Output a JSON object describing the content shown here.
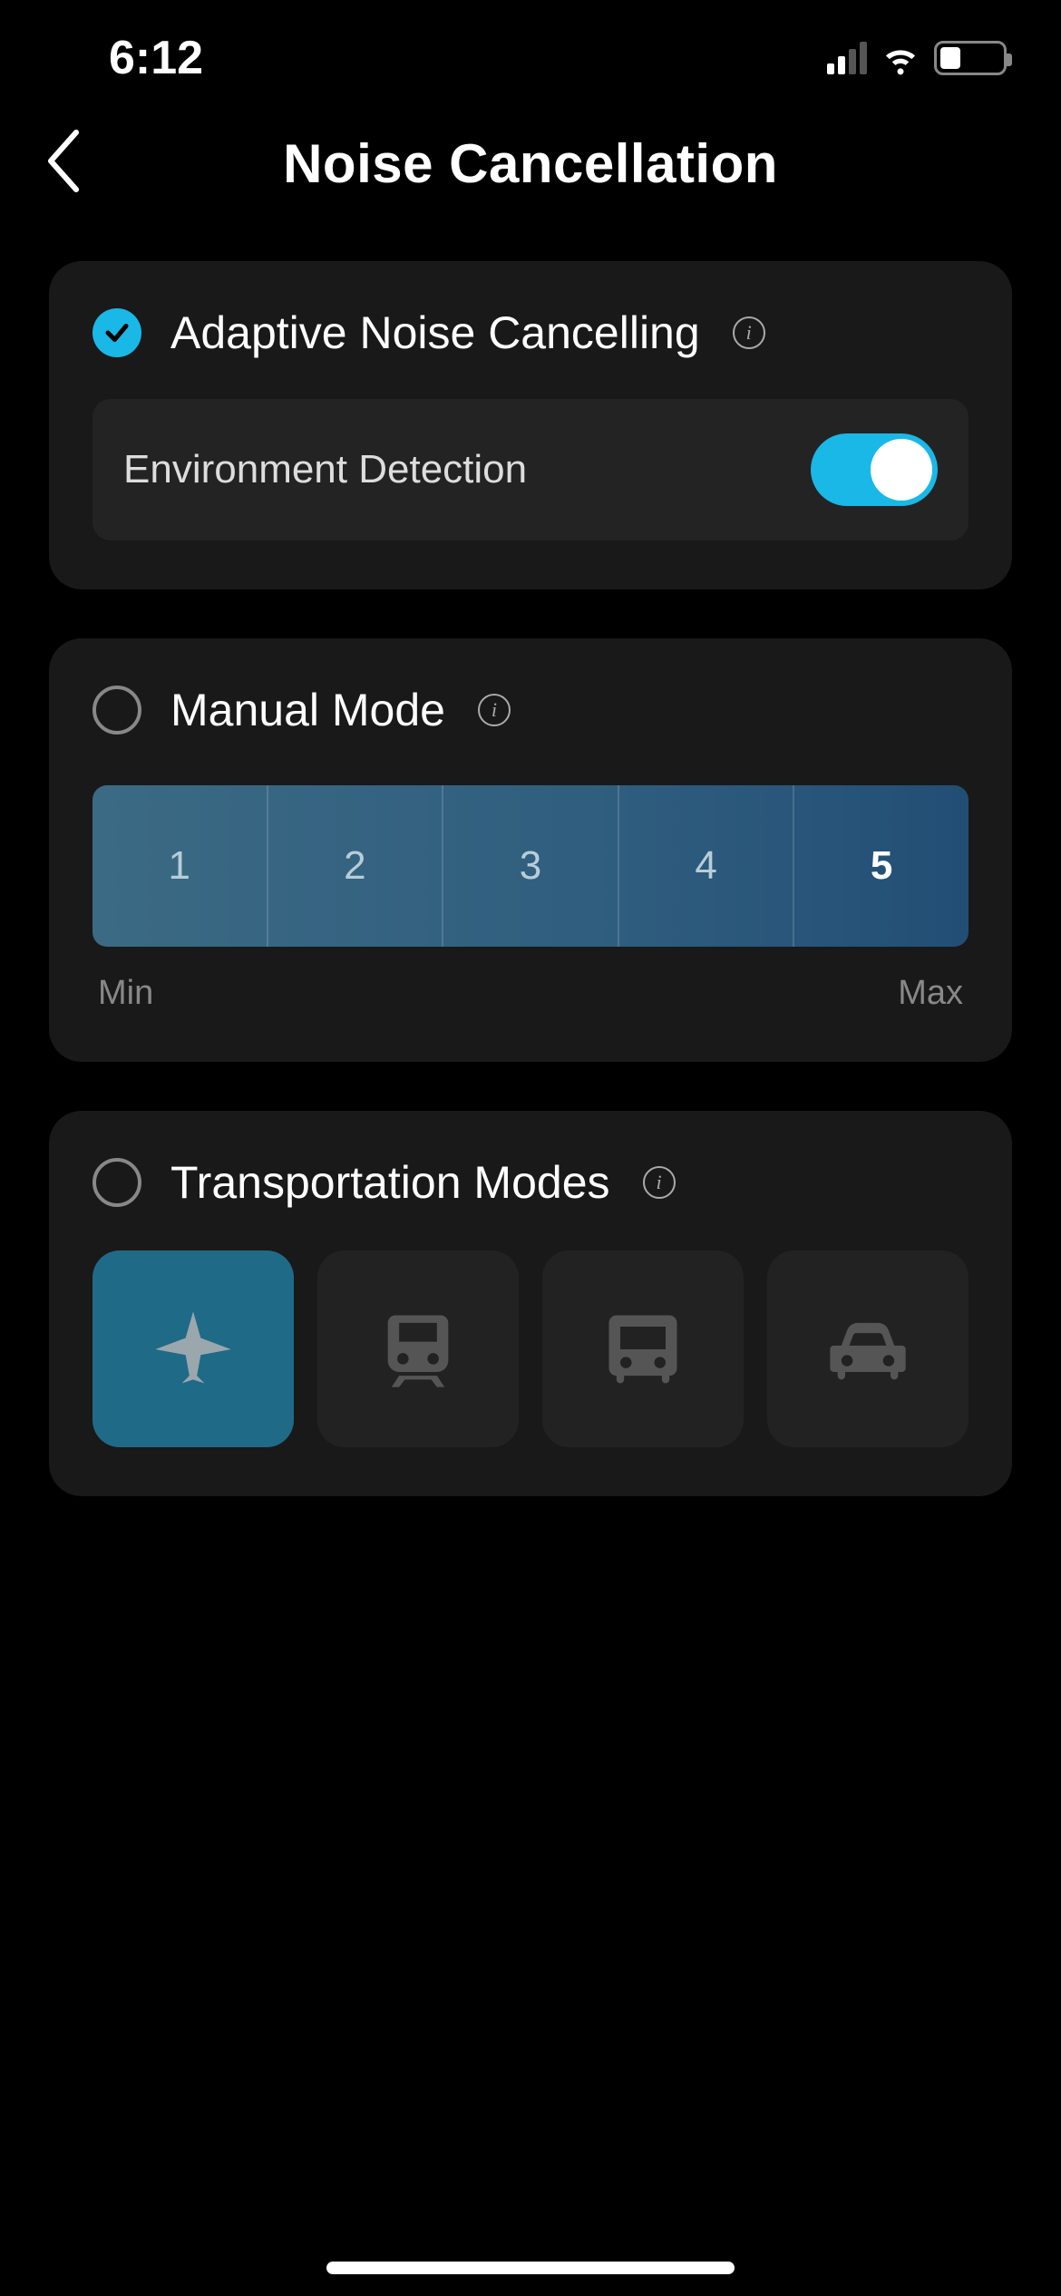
{
  "status": {
    "time": "6:12"
  },
  "header": {
    "title": "Noise Cancellation"
  },
  "card_adaptive": {
    "title": "Adaptive Noise Cancelling",
    "selected": true,
    "env_label": "Environment Detection",
    "env_on": true
  },
  "card_manual": {
    "title": "Manual Mode",
    "selected": false,
    "levels": [
      "1",
      "2",
      "3",
      "4",
      "5"
    ],
    "selected_level": "5",
    "min_label": "Min",
    "max_label": "Max"
  },
  "card_transport": {
    "title": "Transportation Modes",
    "selected": false,
    "modes": [
      "airplane",
      "train",
      "bus",
      "car"
    ],
    "active_mode": "airplane"
  },
  "colors": {
    "accent": "#19b8e6",
    "card_bg": "#191919",
    "tile_active": "#1f6a87"
  }
}
